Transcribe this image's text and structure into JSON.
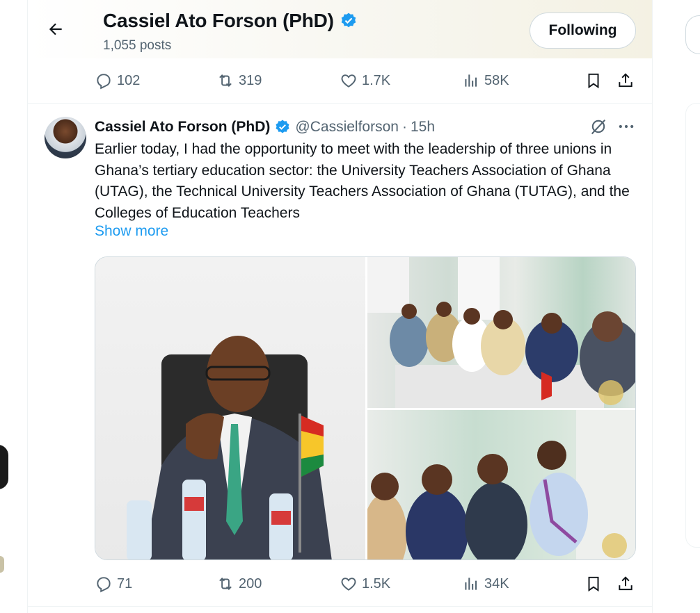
{
  "header": {
    "name": "Cassiel Ato Forson (PhD)",
    "posts": "1,055 posts",
    "follow_label": "Following"
  },
  "prev_post": {
    "replies": "102",
    "reposts": "319",
    "likes": "1.7K",
    "views": "58K"
  },
  "post": {
    "name": "Cassiel Ato Forson (PhD)",
    "handle": "@Cassielforson",
    "separator": "·",
    "time": "15h",
    "text": "Earlier today, I had the opportunity to meet with the leadership of three unions in Ghana’s tertiary education sector: the University Teachers Association of Ghana (UTAG), the Technical University Teachers Association of Ghana (TUTAG), and the Colleges of Education Teachers",
    "show_more": "Show more",
    "replies": "71",
    "reposts": "200",
    "likes": "1.5K",
    "views": "34K"
  },
  "icons": {
    "back": "arrow-left-icon",
    "verified": "verified-badge-icon",
    "reply": "reply-icon",
    "repost": "repost-icon",
    "like": "heart-icon",
    "views": "views-icon",
    "bookmark": "bookmark-icon",
    "share": "share-icon",
    "grok": "grok-icon",
    "more": "more-icon"
  },
  "colors": {
    "accent": "#1d9bf0",
    "text": "#0f1419",
    "muted": "#536471",
    "border": "#cfd9de"
  }
}
